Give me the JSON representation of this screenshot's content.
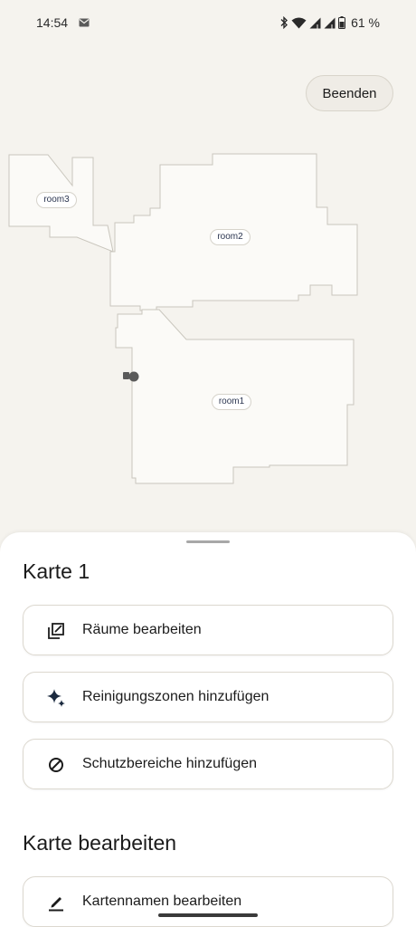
{
  "status_bar": {
    "time": "14:54",
    "battery": "61 %",
    "icons": [
      "mail-icon",
      "bluetooth-icon",
      "wifi-icon",
      "signal-icon",
      "signal-icon",
      "battery-icon"
    ]
  },
  "map": {
    "end_button": "Beenden",
    "rooms": [
      {
        "label": "room3"
      },
      {
        "label": "room2"
      },
      {
        "label": "room1"
      }
    ],
    "robot_icon": "robot-icon"
  },
  "sheet": {
    "title": "Karte 1",
    "options": [
      {
        "label": "Räume bearbeiten",
        "icon": "edit-rooms-icon"
      },
      {
        "label": "Reinigungszonen hinzufügen",
        "icon": "sparkle-icon"
      },
      {
        "label": "Schutzbereiche hinzufügen",
        "icon": "no-entry-icon"
      }
    ],
    "section2_title": "Karte bearbeiten",
    "section2_options": [
      {
        "label": "Kartennamen bearbeiten",
        "icon": "pencil-icon"
      }
    ]
  },
  "colors": {
    "background": "#f5f3ee",
    "room_fill": "#fbfaf7",
    "room_stroke": "#c9c6bd",
    "icon_dark": "#1b2a3f"
  }
}
